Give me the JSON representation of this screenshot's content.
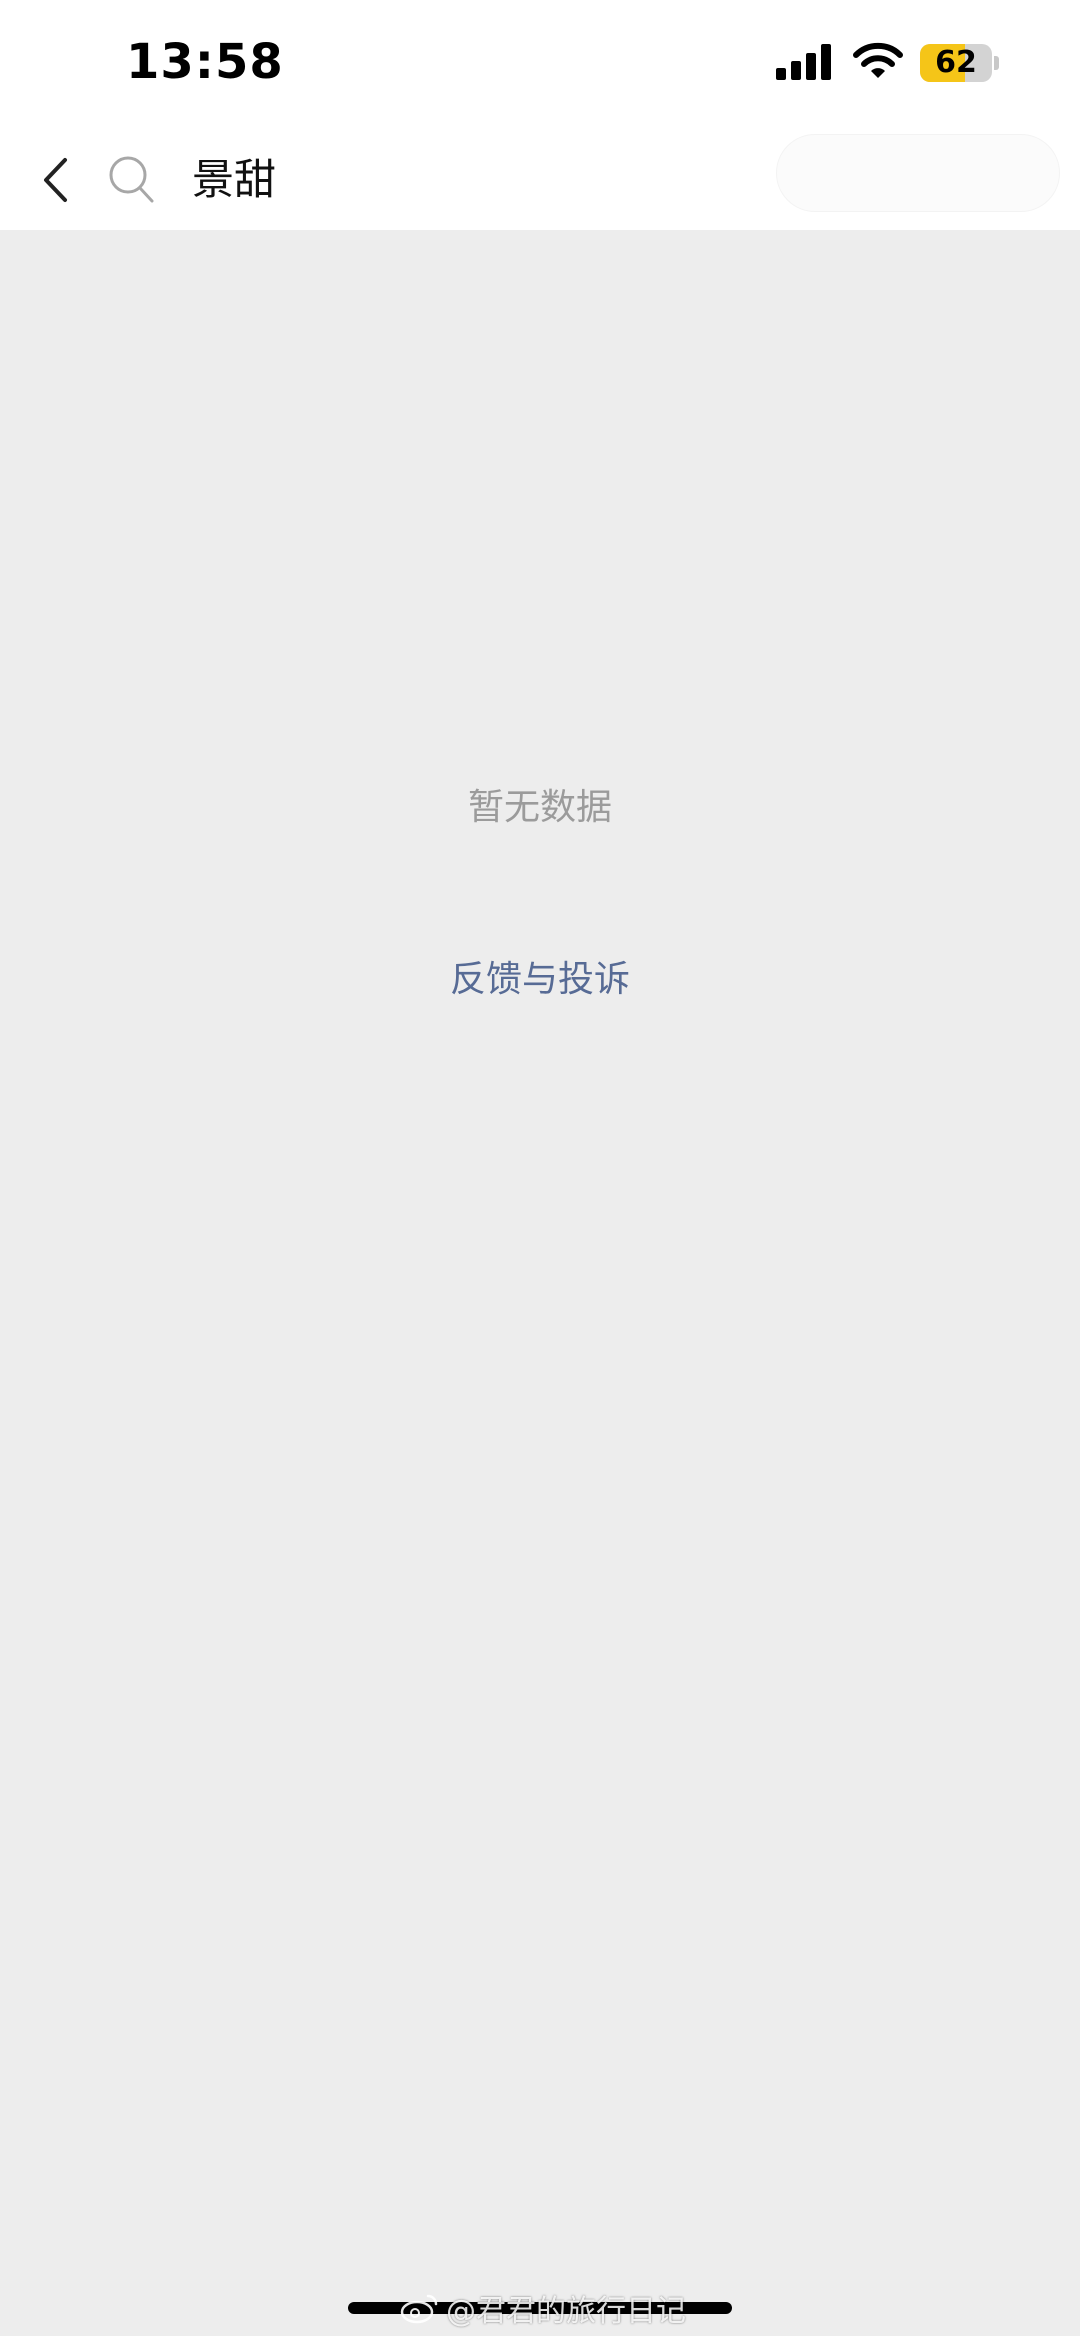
{
  "status_bar": {
    "time": "13:58",
    "battery_level": "62",
    "battery_fraction": 0.62,
    "icons": [
      "signal-icon",
      "wifi-icon",
      "battery-icon"
    ]
  },
  "nav": {
    "back_icon": "chevron-left-icon",
    "search_icon": "search-icon",
    "query": "景甜"
  },
  "content": {
    "empty_message": "暂无数据",
    "feedback_label": "反馈与投诉"
  },
  "watermark": {
    "text": "@君君的旅行日记",
    "icon": "weibo-icon"
  },
  "colors": {
    "background": "#ededed",
    "link": "#576b95",
    "muted_text": "#9b9b9b",
    "battery": "#f5c518"
  }
}
